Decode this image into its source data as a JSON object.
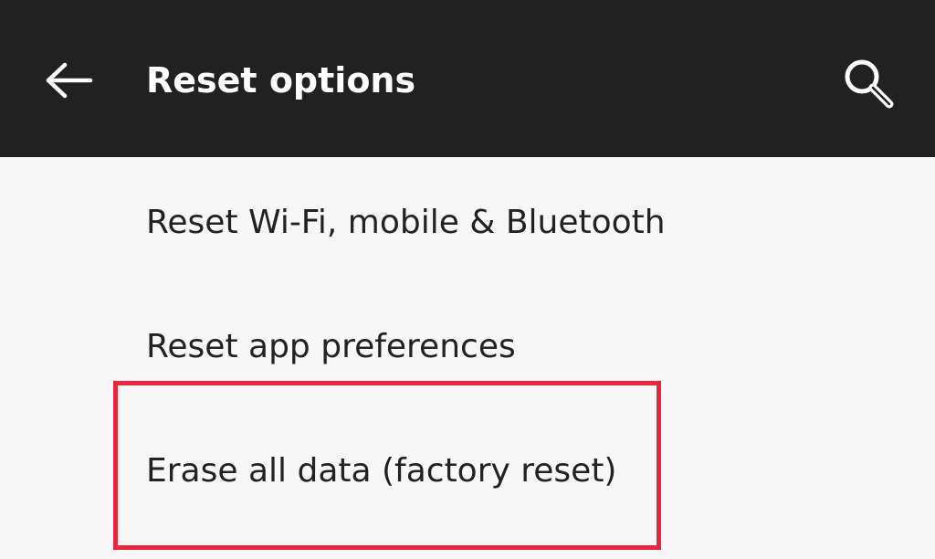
{
  "toolbar": {
    "title": "Reset options",
    "back_icon": "arrow-left-icon",
    "search_icon": "search-icon"
  },
  "list": {
    "items": [
      {
        "label": "Reset Wi-Fi, mobile & Bluetooth"
      },
      {
        "label": "Reset app preferences"
      },
      {
        "label": "Erase all data (factory reset)"
      }
    ]
  },
  "colors": {
    "toolbar_bg": "#212121",
    "page_bg": "#f7f7f7",
    "highlight": "#e8273c"
  }
}
